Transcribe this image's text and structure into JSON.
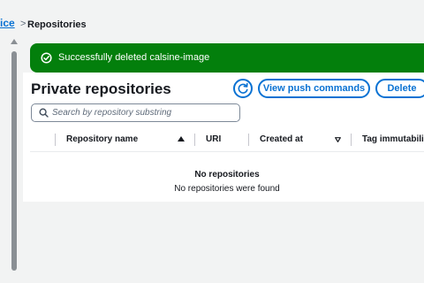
{
  "breadcrumb": {
    "parent_label": "ice",
    "separator": ">",
    "current_label": "Repositories"
  },
  "flash": {
    "message": "Successfully deleted calsine-image",
    "icon": "check-circle-icon",
    "color": "#037f0c"
  },
  "header": {
    "title": "Private repositories",
    "refresh_icon": "refresh-icon",
    "view_push_label": "View push commands",
    "delete_label": "Delete"
  },
  "search": {
    "placeholder": "Search by repository substring",
    "value": ""
  },
  "table": {
    "columns": [
      {
        "label": "Repository name",
        "sort": "ascending"
      },
      {
        "label": "URI",
        "sort": "none"
      },
      {
        "label": "Created at",
        "sort": "none"
      },
      {
        "label": "Tag immutabili",
        "sort": "none"
      }
    ],
    "empty_title": "No repositories",
    "empty_message": "No repositories were found"
  },
  "colors": {
    "accent": "#0972d3",
    "success": "#037f0c",
    "text": "#16191f",
    "background": "#f2f3f3"
  }
}
